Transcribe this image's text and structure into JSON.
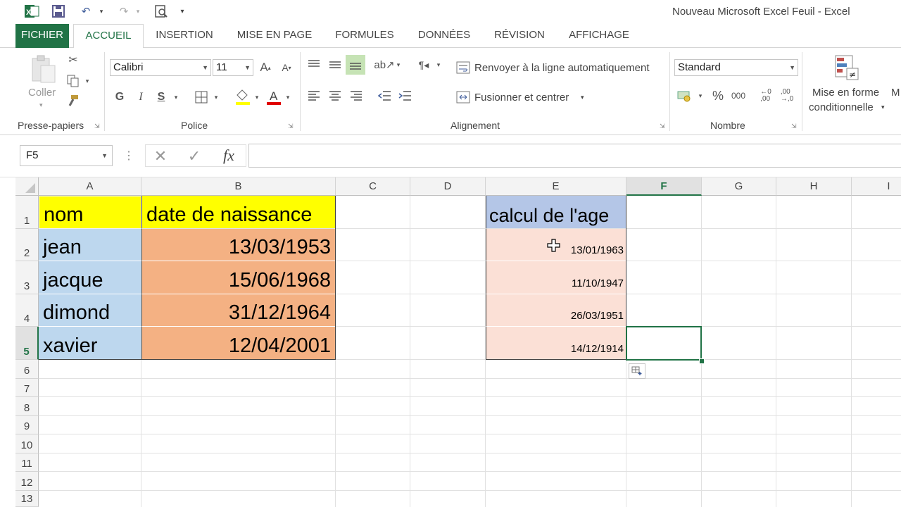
{
  "app": {
    "window_title": "Nouveau Microsoft Excel Feuil - Excel",
    "brand_color": "#217346"
  },
  "qat": {
    "icons": [
      "excel-logo-icon",
      "save-icon",
      "undo-icon",
      "redo-icon",
      "print-preview-icon",
      "customize-qat-icon"
    ]
  },
  "tabs": [
    {
      "label": "FICHIER"
    },
    {
      "label": "ACCUEIL"
    },
    {
      "label": "INSERTION"
    },
    {
      "label": "MISE EN PAGE"
    },
    {
      "label": "FORMULES"
    },
    {
      "label": "DONNÉES"
    },
    {
      "label": "RÉVISION"
    },
    {
      "label": "AFFICHAGE"
    }
  ],
  "ribbon": {
    "clipboard": {
      "paste_label": "Coller",
      "group_label": "Presse-papiers"
    },
    "font": {
      "font_name": "Calibri",
      "font_size": "11",
      "bold": "G",
      "italic": "I",
      "underline": "S",
      "group_label": "Police"
    },
    "alignment": {
      "wrap_label": "Renvoyer à la ligne automatiquement",
      "merge_label": "Fusionner et centrer",
      "group_label": "Alignement"
    },
    "number": {
      "format": "Standard",
      "percent": "%",
      "thousands": "000",
      "group_label": "Nombre"
    },
    "styles": {
      "cond_format_line1": "Mise en forme",
      "cond_format_line2": "conditionnelle",
      "cut_off": "M"
    }
  },
  "formula_bar": {
    "name_box": "F5",
    "fx": "fx",
    "formula": ""
  },
  "columns": [
    "A",
    "B",
    "C",
    "D",
    "E",
    "F",
    "G",
    "H",
    "I"
  ],
  "selected_column": "F",
  "rows": [
    "1",
    "2",
    "3",
    "4",
    "5",
    "6",
    "7",
    "8",
    "9",
    "10",
    "11",
    "12",
    "13"
  ],
  "selected_row": "5",
  "cells": {
    "A1": "nom",
    "B1": "date de naissance",
    "E1": "calcul de l'age",
    "A2": "jean",
    "B2": "13/03/1953",
    "E2": "13/01/1963",
    "A3": "jacque",
    "B3": "15/06/1968",
    "E3": "11/10/1947",
    "A4": "dimond",
    "B4": "31/12/1964",
    "E4": "26/03/1951",
    "A5": "xavier",
    "B5": "12/04/2001",
    "E5": "14/12/1914"
  },
  "fills": {
    "header_yellow": "#ffff00",
    "name_blue": "#bdd7ee",
    "date_orange": "#f4b183",
    "age_header": "#b4c6e7",
    "age_pink": "#fbe0d6"
  }
}
